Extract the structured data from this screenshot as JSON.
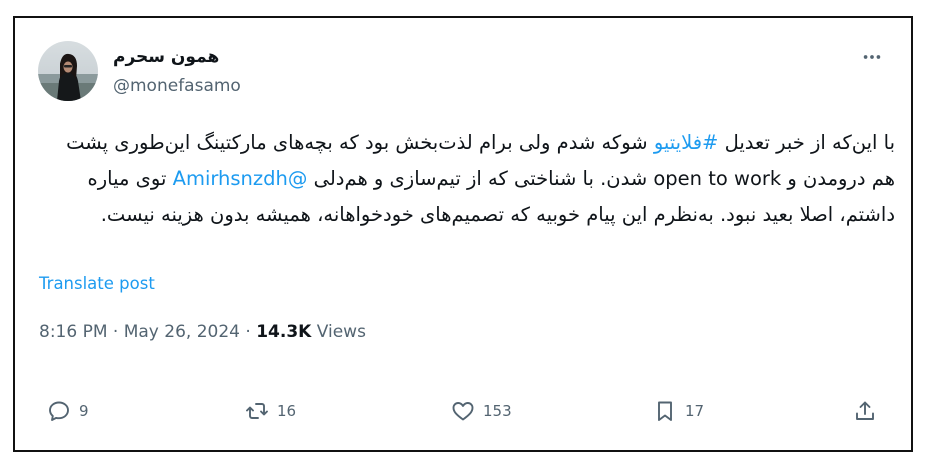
{
  "user": {
    "display_name": "همون سحرم",
    "handle": "@monefasamo"
  },
  "tweet": {
    "segments": [
      {
        "text": "با این‌که از خبر تعدیل ",
        "type": "text"
      },
      {
        "text": "#فلایتیو",
        "type": "link"
      },
      {
        "text": " شوکه شدم ولی برام لذت‌بخش بود که بچه‌های مارکتینگ این‌طوری پشت هم درومدن و open to work شدن. با شناختی که از تیم‌سازی و هم‌دلی ",
        "type": "text"
      },
      {
        "text": "@Amirhsnzdh",
        "type": "link"
      },
      {
        "text": " توی میاره داشتم، اصلا بعید نبود. به‌نظرم این پیام خوبیه که تصمیم‌های خودخواهانه، همیشه بدون هزینه نیست.",
        "type": "text"
      }
    ],
    "translate_label": "Translate post"
  },
  "meta": {
    "time": "8:16 PM",
    "date": "May 26, 2024",
    "separator": "·",
    "views_count": "14.3K",
    "views_label": "Views"
  },
  "actions": {
    "replies": "9",
    "reposts": "16",
    "likes": "153",
    "bookmarks": "17"
  },
  "icons": {
    "more": "more-horizontal-icon",
    "reply": "reply-bubble-icon",
    "repost": "repost-icon",
    "like": "heart-icon",
    "bookmark": "bookmark-icon",
    "share": "share-upload-icon"
  },
  "colors": {
    "link": "#1d9bf0",
    "secondary": "#536471",
    "primary": "#0f1419",
    "border": "#111111"
  }
}
